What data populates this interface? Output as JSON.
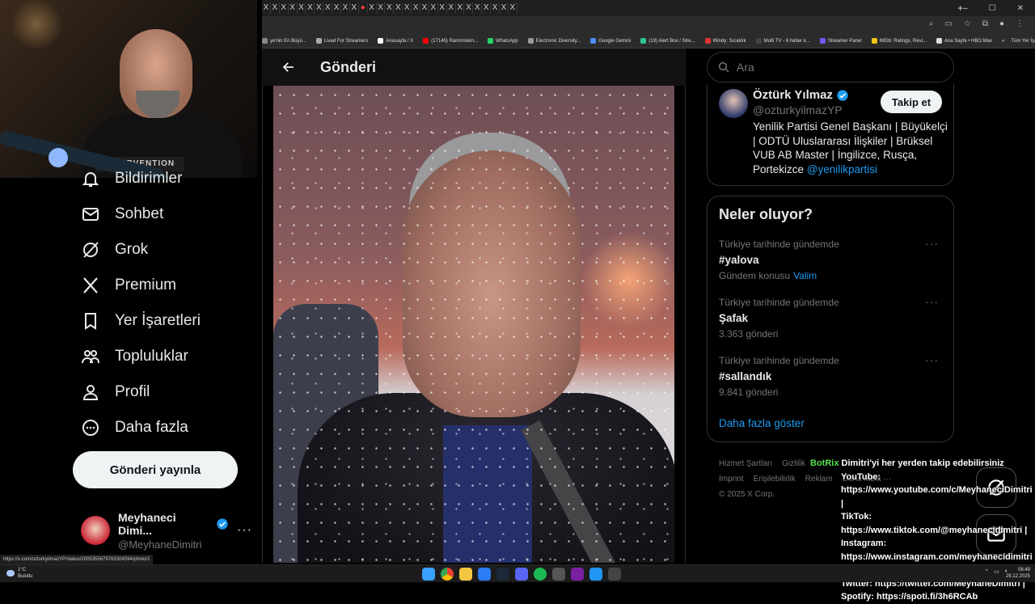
{
  "browser": {
    "tabs_count": 29,
    "new_tab": "+",
    "window_controls": [
      "–",
      "☐",
      "✕"
    ],
    "bookmarks": [
      {
        "label": "ye'nin En Büyü...",
        "color": "#888"
      },
      {
        "label": "Livad For Streamers",
        "color": "#aaa"
      },
      {
        "label": "Anasayfa / X",
        "color": "#fff"
      },
      {
        "label": "(17145) Rammstein...",
        "color": "#ff0000"
      },
      {
        "label": "WhatsApp",
        "color": "#25d366"
      },
      {
        "label": "Electronic Diversity...",
        "color": "#999"
      },
      {
        "label": "Google Gemini",
        "color": "#4b8cff"
      },
      {
        "label": "(19) Alert Box / Stre...",
        "color": "#31c48d"
      },
      {
        "label": "Windy: Sıcaklık",
        "color": "#d33"
      },
      {
        "label": "Multi TV - 6 haber k...",
        "color": "#444"
      },
      {
        "label": "Streamer Panel",
        "color": "#6f5cff"
      },
      {
        "label": "IMDb: Ratings, Revi...",
        "color": "#f5c518"
      },
      {
        "label": "Ana Sayfa • HBO Max",
        "color": "#ddd"
      }
    ],
    "all_bookmarks": "Tüm Yer İşaretleri",
    "status_url": "https://x.com/ozturkyilmazYP/status/2005355679763304594/photo/1"
  },
  "webcam": {
    "shirt_text": "INTERVENTION"
  },
  "sidebar": {
    "items": [
      {
        "label": "Bildirimler",
        "icon": "bell-icon"
      },
      {
        "label": "Sohbet",
        "icon": "mail-icon"
      },
      {
        "label": "Grok",
        "icon": "grok-icon"
      },
      {
        "label": "Premium",
        "icon": "x-logo-icon"
      },
      {
        "label": "Yer İşaretleri",
        "icon": "bookmark-icon"
      },
      {
        "label": "Topluluklar",
        "icon": "people-icon"
      },
      {
        "label": "Profil",
        "icon": "person-icon"
      },
      {
        "label": "Daha fazla",
        "icon": "more-circle-icon"
      }
    ],
    "post_button": "Gönderi yayınla",
    "account": {
      "display_name": "Meyhaneci Dimi...",
      "handle": "@MeyhaneDimitri",
      "more": "···"
    }
  },
  "post": {
    "header_title": "Gönderi"
  },
  "right": {
    "search_placeholder": "Ara",
    "profile": {
      "name": "Öztürk Yılmaz",
      "handle": "@ozturkyilmazYP",
      "follow_label": "Takip et",
      "bio": "Yenilik Partisi Genel Başkanı | Büyükelçi | ODTÜ Uluslararası İlişkiler | Brüksel VUB AB Master | İngilizce, Rusça, Portekizce",
      "bio_link": "@yenilikpartisi"
    },
    "trends_title": "Neler oluyor?",
    "trends": [
      {
        "context": "Türkiye tarihinde gündemde",
        "name": "#yalova",
        "meta": "Gündem konusu",
        "meta_link": "Valim"
      },
      {
        "context": "Türkiye tarihinde gündemde",
        "name": "Şafak",
        "meta": "3.363 gönderi",
        "meta_link": ""
      },
      {
        "context": "Türkiye tarihinde gündemde",
        "name": "#sallandık",
        "meta": "9.841 gönderi",
        "meta_link": ""
      }
    ],
    "show_more": "Daha fazla göster",
    "footer": {
      "line1": [
        "Hizmet Şartları",
        "Gizlilik"
      ],
      "line2": [
        "Imprint",
        "Erişilebilirlik",
        "Reklam"
      ],
      "more": "Daha fazla ···",
      "copyright": "© 2025 X Corp."
    }
  },
  "chat": {
    "bot_name": "BotRix",
    "lines": [
      "Dimitri'yi her yerden takip edebilirsiniz",
      "YouTube:",
      "https://www.youtube.com/c/MeyhaneciDimitri |",
      "TikTok:",
      "https://www.tiktok.com/@meyhanecidimitri |",
      "Instagram:",
      "https://www.instagram.com/meyhanecidimitri |",
      "Twitter: https://twitter.com/MeyhaneDimitri |",
      "Spotify: https://spoti.fi/3h6RCAb"
    ]
  },
  "taskbar": {
    "weather_temp": "1°C",
    "weather_desc": "Bulutlu",
    "time": "08:49",
    "date": "29.12.2025"
  },
  "colors": {
    "accent": "#1d9bf0",
    "background": "#000000",
    "border": "#2f3336",
    "muted": "#71767b",
    "botrix": "#57e04f"
  }
}
